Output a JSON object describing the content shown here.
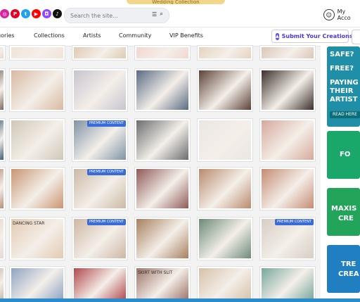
{
  "promo": {
    "text": "Wedding Collection"
  },
  "socials": [
    {
      "name": "instagram-icon",
      "color": "#d6249f",
      "glyph": "◎"
    },
    {
      "name": "pinterest-icon",
      "color": "#e60023",
      "glyph": "P"
    },
    {
      "name": "twitter-icon",
      "color": "#1da1f2",
      "glyph": "t"
    },
    {
      "name": "youtube-icon",
      "color": "#ff0000",
      "glyph": "▶"
    },
    {
      "name": "twitch-icon",
      "color": "#9146ff",
      "glyph": "◘"
    },
    {
      "name": "tiktok-icon",
      "color": "#111111",
      "glyph": "♪"
    }
  ],
  "search": {
    "placeholder": "Search the site...",
    "filter_icon": "filter-icon",
    "search_icon": "search-icon"
  },
  "account": {
    "label": "My Acco",
    "icon": "user-icon"
  },
  "nav": {
    "items": [
      "gories",
      "Collections",
      "Artists",
      "Community",
      "VIP Benefits"
    ],
    "submit_label": "Submit Your Creations"
  },
  "tiles": {
    "badge": "PREMIUM CONTENT",
    "caption_skirt": "SKIRT WITH SLIT",
    "caption_necklace": "DANCING STAR"
  },
  "ads": [
    {
      "lines": [
        "SAFE?",
        "FREE?",
        "PAYING",
        "THEIR",
        "ARTIST"
      ],
      "button": "READ HERE",
      "color": "#1f8fa8"
    },
    {
      "lines": [
        "FO"
      ],
      "color": "#1aa86a"
    },
    {
      "lines": [
        "MAXIS",
        "CRE"
      ],
      "color": "#22a45b"
    },
    {
      "lines": [
        "TRE",
        "CREA"
      ],
      "color": "#1f7fc0"
    }
  ],
  "colors": {
    "accent": "#4a3ad6",
    "footer": "#2b8ccc"
  }
}
